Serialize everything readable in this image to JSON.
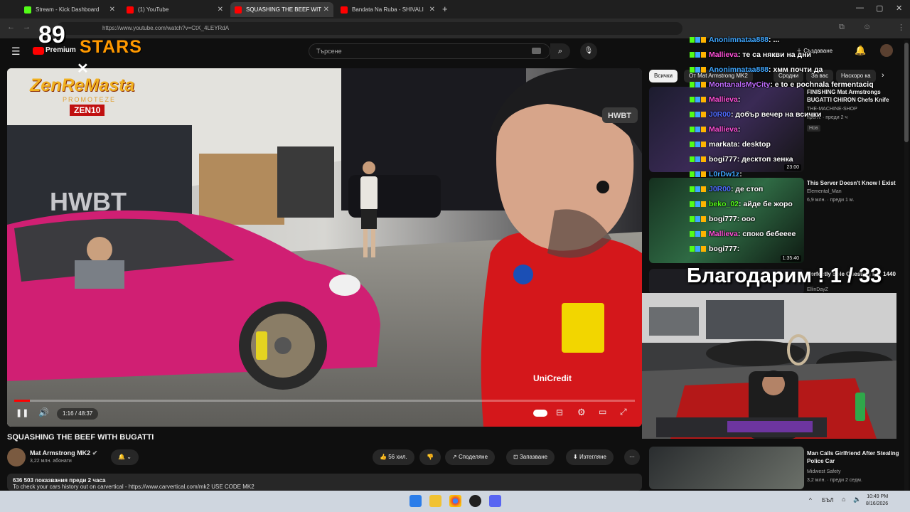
{
  "browser": {
    "tabs": [
      {
        "label": "Stream - Kick Dashboard",
        "color": "#53fc18"
      },
      {
        "label": "(1) YouTube",
        "color": "#ff0000"
      },
      {
        "label": "SQUASHING THE BEEF WIT",
        "color": "#ff0000"
      },
      {
        "label": "Bandata Na Ruba - SHIVALI",
        "color": "#ff0000"
      }
    ],
    "url": "https://www.youtube.com/watch?v=CtX_4LEYRdA"
  },
  "youtube": {
    "logo_text": "Premium",
    "search_placeholder": "Търсене",
    "create_label": "Създаване"
  },
  "overlay": {
    "logo_number": "89",
    "logo_word": "STARS",
    "brand_text": "ZenReMasta",
    "brand_sub": "PROMOTEZE",
    "brand_code": "ZEN10",
    "thanks_text": "Благодарим ! 1 / 33"
  },
  "video": {
    "time": "1:16 / 48:37",
    "progress_fraction": 0.025,
    "title": "SQUASHING THE BEEF WITH BUGATTI",
    "channel": "Mat Armstrong MK2",
    "subscribers": "3,22 млн. абонати",
    "likes": "56 хил.",
    "share": "Споделяне",
    "save": "Запазване",
    "download": "Изтегляне",
    "views_line": "636 503 показвания  преди 2 часа",
    "desc_line": "To check your cars history out on carvertical - https://www.carvertical.com/mk2 USE CODE MK2"
  },
  "sidebar": {
    "chips": [
      "Всички",
      "От Mat Armstrong MK2",
      "Сродни",
      "За вас",
      "Наскоро ка"
    ],
    "recs": [
      {
        "title": "FINISHING Mat Armstrongs BUGATTI CHIRON Chefs Knife",
        "channel": "THE-MACHINE-SHOP",
        "meta": "прегл. · преди 2 ч",
        "badge": "Нов",
        "dur": "23:00"
      },
      {
        "title": "This Server Doesn't Know I Exist",
        "channel": "Elemental_Man",
        "meta": "6,9 млн. · преди 1 м.",
        "dur": "1:35:40"
      },
      {
        "title": "Perfectly Sole Questing For 1440",
        "channel": "EllinDayZ",
        "meta": "",
        "dur": ""
      },
      {
        "title": "Man Calls Girlfriend After Stealing Police Car",
        "channel": "Midwest Safety",
        "meta": "3,2 млн. · преди 2 седм.",
        "dur": ""
      }
    ]
  },
  "chat": [
    {
      "user": "Anonimnataa888",
      "msg": ": ...",
      "color": "#3ea6ff"
    },
    {
      "user": "Mallieva",
      "msg": ": те са някви на дни",
      "color": "#ff4fd8"
    },
    {
      "user": "Anonimnataa888",
      "msg": ": хмм почти да",
      "color": "#3ea6ff"
    },
    {
      "user": "MontanalsMyCity",
      "msg": ": e to e pochnala fermentaciq",
      "color": "#c06bff"
    },
    {
      "user": "Mallieva",
      "msg": ": ",
      "color": "#ff4fd8"
    },
    {
      "user": "J0R00",
      "msg": ": добър вечер на всички",
      "color": "#4f6bff"
    },
    {
      "user": "Mallieva",
      "msg": ": ",
      "color": "#ff4fd8"
    },
    {
      "user": "markata",
      "msg": ": desktop",
      "color": "#ffffff"
    },
    {
      "user": "bogi777",
      "msg": ": десктоп зенка",
      "color": "#ffffff"
    },
    {
      "user": "L0rDw1z",
      "msg": ": ",
      "color": "#3ea6ff"
    },
    {
      "user": "J0R00",
      "msg": ": де стоп",
      "color": "#4f6bff"
    },
    {
      "user": "beko_02",
      "msg": ": айде бе жоро",
      "color": "#53fc18"
    },
    {
      "user": "bogi777",
      "msg": ": ооо",
      "color": "#ffffff"
    },
    {
      "user": "Mallieva",
      "msg": ": споко бебееее",
      "color": "#ff4fd8"
    },
    {
      "user": "bogi777",
      "msg": ": ",
      "color": "#ffffff"
    }
  ],
  "taskbar": {
    "time": "10:49 PM",
    "date": "8/16/2026",
    "lang": "БЪЛ"
  }
}
